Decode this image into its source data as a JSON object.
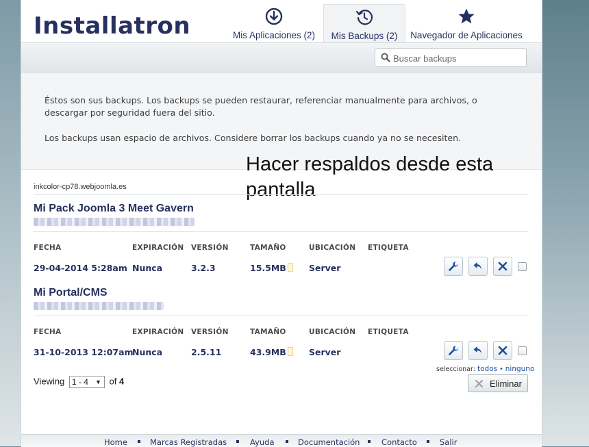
{
  "brand": {
    "logo_text": "Installatron"
  },
  "tabs": [
    {
      "label": "Mis Aplicaciones (2)",
      "icon": "download-circle-icon",
      "active": false
    },
    {
      "label": "Mis Backups (2)",
      "icon": "history-clock-icon",
      "active": true
    },
    {
      "label": "Navegador de Aplicaciones",
      "icon": "star-icon",
      "active": false
    }
  ],
  "search": {
    "placeholder": "Buscar backups"
  },
  "intro": {
    "line1": "Éstos son sus backups. Los backups se pueden restaurar, referenciar manualmente para archivos, o descargar por seguridad fuera del sitio.",
    "line2": "Los backups usan espacio de archivos. Considere borrar los backups cuando ya no se necesiten."
  },
  "overlay": {
    "text": "Hacer respaldos desde esta pantalla"
  },
  "domain": "inkcolor-cp78.webjoomla.es",
  "columns": {
    "fecha": "FECHA",
    "expiracion": "EXPIRACIÓN",
    "version": "VERSIÓN",
    "tamano": "TAMAÑO",
    "ubicacion": "UBICACIÓN",
    "etiqueta": "ETIQUETA"
  },
  "backups": [
    {
      "title": "Mi Pack Joomla 3 Meet Gavern",
      "fecha": "29-04-2014 5:28am",
      "expiracion": "Nunca",
      "version": "3.2.3",
      "tamano": "15.5MB",
      "ubicacion": "Server",
      "etiqueta": ""
    },
    {
      "title": "Mi Portal/CMS",
      "fecha": "31-10-2013 12:07am",
      "expiracion": "Nunca",
      "version": "2.5.11",
      "tamano": "43.9MB",
      "ubicacion": "Server",
      "etiqueta": ""
    }
  ],
  "selection": {
    "prefix": "seleccionar:",
    "all": "todos",
    "bullet": "•",
    "none": "ninguno"
  },
  "pagination": {
    "viewing_label": "Viewing",
    "range": "1 - 4",
    "of_label": "of",
    "total": "4"
  },
  "delete_button": {
    "label": "Eliminar"
  },
  "footer": [
    "Home",
    "Marcas Registradas",
    "Ayuda",
    "Documentación",
    "Contacto",
    "Salir"
  ],
  "colors": {
    "brand_navy": "#26305e",
    "link_blue": "#1f4fa3",
    "action_blue": "#1c4fa0"
  }
}
